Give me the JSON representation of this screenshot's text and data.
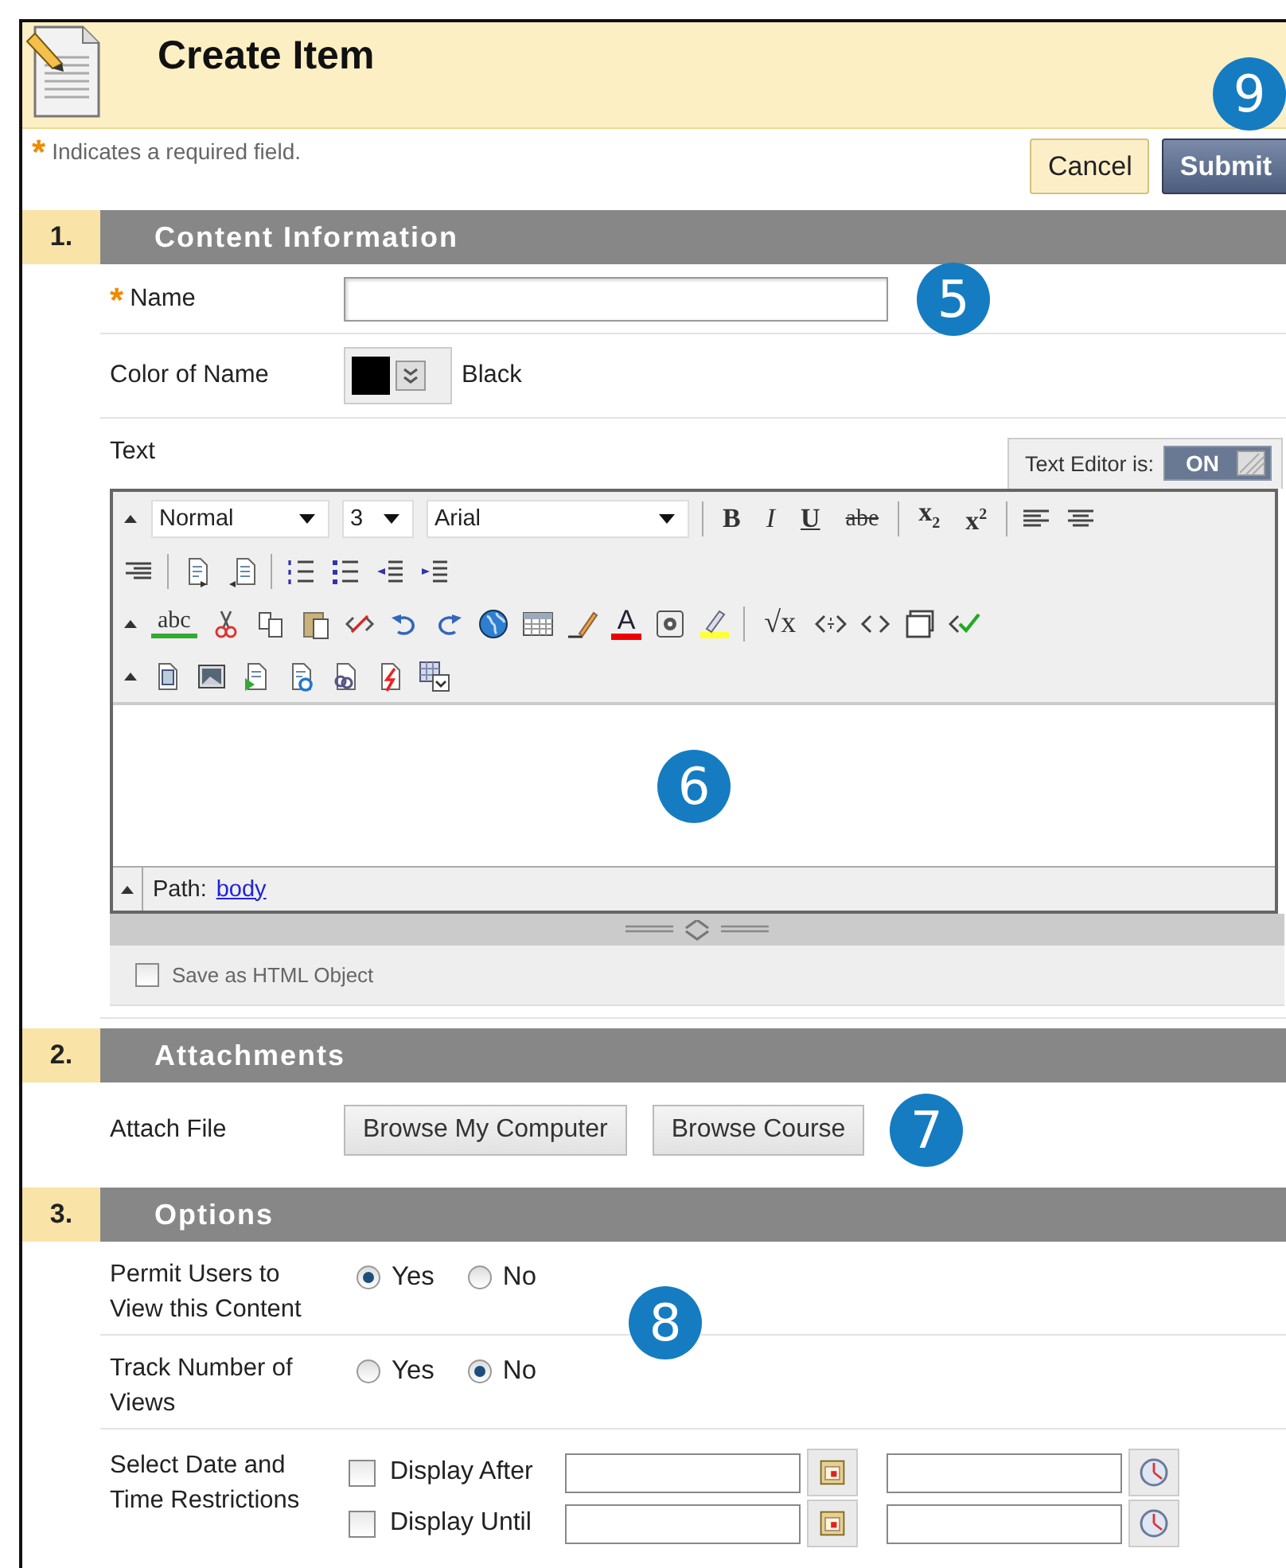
{
  "header": {
    "title": "Create Item",
    "callout": "9"
  },
  "required_note": {
    "mark": "*",
    "text": "Indicates a required field."
  },
  "buttons": [
    {
      "label": "Cancel",
      "kind": "secondary"
    },
    {
      "label": "Submit",
      "kind": "primary"
    }
  ],
  "sections": [
    {
      "number": "1.",
      "title": "Content Information",
      "fields": [
        {
          "kind": "text-input",
          "label": "Name",
          "required_mark": "*",
          "callout": "5"
        },
        {
          "kind": "color",
          "label": "Color of Name",
          "value": "Black",
          "color": "#000000"
        },
        {
          "kind": "editor",
          "label": "Text",
          "toggle": {
            "label": "Text Editor is:",
            "state": "ON",
            "on": true
          },
          "toolbar": [
            [
              {
                "kind": "collapse"
              },
              {
                "kind": "select",
                "value": "Normal"
              },
              {
                "kind": "select",
                "value": "3"
              },
              {
                "kind": "select",
                "value": "Arial"
              },
              {
                "kind": "separator"
              },
              {
                "kind": "glyph",
                "label": "B"
              },
              {
                "kind": "glyph",
                "label": "I"
              },
              {
                "kind": "glyph",
                "label": "U"
              },
              {
                "kind": "glyph",
                "label": "abe"
              },
              {
                "kind": "separator"
              },
              {
                "kind": "glyph",
                "label": "x$_{2}$"
              },
              {
                "kind": "glyph",
                "label": "x$^{2}$"
              },
              {
                "kind": "separator"
              },
              {
                "kind": "icon"
              },
              {
                "kind": "icon"
              }
            ],
            [
              {
                "kind": "icon"
              },
              {
                "kind": "separator"
              },
              {
                "kind": "icon"
              },
              {
                "kind": "icon"
              },
              {
                "kind": "separator"
              },
              {
                "kind": "icon"
              },
              {
                "kind": "icon"
              },
              {
                "kind": "icon"
              },
              {
                "kind": "icon"
              }
            ],
            [
              {
                "kind": "collapse"
              },
              {
                "kind": "glyph",
                "label": "abc"
              },
              {
                "kind": "icon"
              },
              {
                "kind": "icon"
              },
              {
                "kind": "icon"
              },
              {
                "kind": "icon"
              },
              {
                "kind": "icon"
              },
              {
                "kind": "icon"
              },
              {
                "kind": "icon"
              },
              {
                "kind": "icon"
              },
              {
                "kind": "icon"
              },
              {
                "kind": "glyph",
                "label": "A"
              },
              {
                "kind": "icon"
              },
              {
                "kind": "icon"
              },
              {
                "kind": "separator"
              },
              {
                "kind": "glyph",
                "label": "√x"
              },
              {
                "kind": "icon"
              },
              {
                "kind": "icon"
              },
              {
                "kind": "icon"
              },
              {
                "kind": "icon"
              }
            ],
            [
              {
                "kind": "collapse"
              },
              {
                "kind": "icon"
              },
              {
                "kind": "icon"
              },
              {
                "kind": "icon"
              },
              {
                "kind": "icon"
              },
              {
                "kind": "icon"
              },
              {
                "kind": "icon"
              },
              {
                "kind": "icon"
              }
            ]
          ],
          "callout": "6",
          "path_label": "Path:",
          "path_link": "body",
          "html_option": {
            "label": "Save as HTML Object",
            "checked": false
          }
        }
      ]
    },
    {
      "number": "2.",
      "title": "Attachments",
      "fields": [
        {
          "kind": "file",
          "label": "Attach File",
          "buttons": [
            "Browse My Computer",
            "Browse Course"
          ],
          "callout": "7"
        }
      ]
    },
    {
      "number": "3.",
      "title": "Options",
      "callout": "8",
      "fields": [
        {
          "kind": "radio",
          "label": "Permit Users to View this Content",
          "options": [
            {
              "label": "Yes",
              "selected": true
            },
            {
              "label": "No",
              "selected": false
            }
          ]
        },
        {
          "kind": "radio",
          "label": "Track Number of Views",
          "options": [
            {
              "label": "Yes",
              "selected": false
            },
            {
              "label": "No",
              "selected": true
            }
          ]
        },
        {
          "kind": "dates",
          "label": "Select Date and Time Restrictions",
          "rows": [
            {
              "label": "Display After",
              "checked": false
            },
            {
              "label": "Display Until",
              "checked": false
            }
          ]
        }
      ]
    }
  ]
}
